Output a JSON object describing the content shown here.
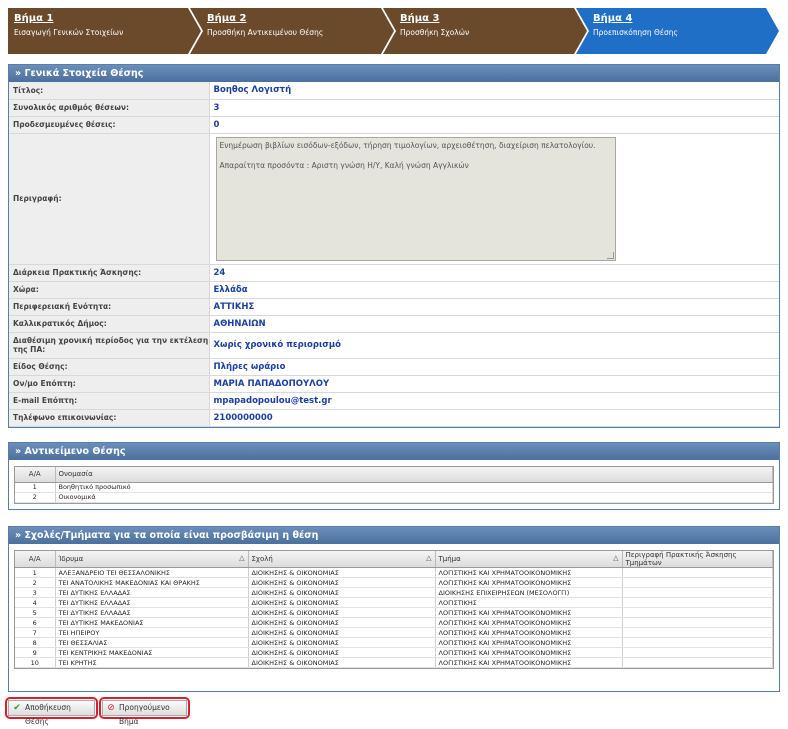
{
  "wizard": {
    "steps": [
      {
        "title": "Βήμα 1",
        "subtitle": "Εισαγωγή Γενικών Στοιχείων"
      },
      {
        "title": "Βήμα 2",
        "subtitle": "Προσθήκη Αντικειμένου Θέσης"
      },
      {
        "title": "Βήμα 3",
        "subtitle": "Προσθήκη Σχολών"
      },
      {
        "title": "Βήμα 4",
        "subtitle": "Προεπισκόπηση Θέσης"
      }
    ],
    "colors": {
      "done": "#6b4a2b",
      "active": "#1f6fc6"
    }
  },
  "general": {
    "header": "» Γενικά Στοιχεία Θέσης",
    "fields": [
      {
        "label": "Τίτλος:",
        "value": "Βοηθος Λογιστή"
      },
      {
        "label": "Συνολικός αριθμός θέσεων:",
        "value": "3"
      },
      {
        "label": "Προδεσμευμένες θέσεις:",
        "value": "0"
      },
      {
        "label": "Περιγραφή:",
        "value": ""
      },
      {
        "label": "Διάρκεια Πρακτικής Άσκησης:",
        "value": "24"
      },
      {
        "label": "Χώρα:",
        "value": "Ελλάδα"
      },
      {
        "label": "Περιφερειακή Ενότητα:",
        "value": "ΑΤΤΙΚΗΣ"
      },
      {
        "label": "Καλλικρατικός Δήμος:",
        "value": "ΑΘΗΝΑΙΩΝ"
      },
      {
        "label": "Διαθέσιμη χρονική περίοδος για την εκτέλεση της ΠΑ:",
        "value": "Χωρίς χρονικό περιορισμό"
      },
      {
        "label": "Είδος Θέσης:",
        "value": "Πλήρες ωράριο"
      },
      {
        "label": "Ον/μο Επόπτη:",
        "value": "ΜΑΡΙΑ ΠΑΠΑΔΟΠΟΥΛΟΥ"
      },
      {
        "label": "E-mail Επόπτη:",
        "value": "mpapadopoulou@test.gr"
      },
      {
        "label": "Τηλέφωνο επικοινωνίας:",
        "value": "2100000000"
      }
    ],
    "description_line1": "Ενημέρωση βιβλίων εισόδων-εξόδων, τήρηση τιμολογίων, αρχειοθέτηση, διαχείριση πελατολογίου.",
    "description_line2": "Απαραίτητα προσόντα : Αριστη γνώση Η/Υ, Καλή γνώση Αγγλικών"
  },
  "objects": {
    "header": "» Αντικείμενο Θέσης",
    "columns": [
      "Α/Α",
      "Ονομασία"
    ],
    "rows": [
      [
        "1",
        "Βοηθητικό προσωπικό"
      ],
      [
        "2",
        "Οικονομικά"
      ]
    ]
  },
  "schools": {
    "header": "» Σχολές/Τμήματα για τα οποία είναι προσβάσιμη η θέση",
    "columns": [
      "Α/Α",
      "Ίδρυμα",
      "Σχολή",
      "Τμήμα",
      "Περιγραφή Πρακτικής Άσκησης Τμημάτων"
    ],
    "rows": [
      [
        "1",
        "ΑΛΕΞΑΝΔΡΕΙΟ ΤΕΙ ΘΕΣΣΑΛΟΝΙΚΗΣ",
        "ΔΙΟΙΚΗΣΗΣ & ΟΙΚΟΝΟΜΙΑΣ",
        "ΛΟΓΙΣΤΙΚΗΣ ΚΑΙ ΧΡΗΜΑΤΟΟΙΚΟΝΟΜΙΚΗΣ",
        ""
      ],
      [
        "2",
        "ΤΕΙ ΑΝΑΤΟΛΙΚΗΣ ΜΑΚΕΔΟΝΙΑΣ ΚΑΙ ΘΡΑΚΗΣ",
        "ΔΙΟΙΚΗΣΗΣ & ΟΙΚΟΝΟΜΙΑΣ",
        "ΛΟΓΙΣΤΙΚΗΣ ΚΑΙ ΧΡΗΜΑΤΟΟΙΚΟΝΟΜΙΚΗΣ",
        ""
      ],
      [
        "3",
        "ΤΕΙ ΔΥΤΙΚΗΣ ΕΛΛΑΔΑΣ",
        "ΔΙΟΙΚΗΣΗΣ & ΟΙΚΟΝΟΜΙΑΣ",
        "ΔΙΟΙΚΗΣΗΣ ΕΠΙΧΕΙΡΗΣΕΩΝ (ΜΕΣΟΛΟΓΓΙ)",
        ""
      ],
      [
        "4",
        "ΤΕΙ ΔΥΤΙΚΗΣ ΕΛΛΑΔΑΣ",
        "ΔΙΟΙΚΗΣΗΣ & ΟΙΚΟΝΟΜΙΑΣ",
        "ΛΟΓΙΣΤΙΚΗΣ",
        ""
      ],
      [
        "5",
        "ΤΕΙ ΔΥΤΙΚΗΣ ΕΛΛΑΔΑΣ",
        "ΔΙΟΙΚΗΣΗΣ & ΟΙΚΟΝΟΜΙΑΣ",
        "ΛΟΓΙΣΤΙΚΗΣ ΚΑΙ ΧΡΗΜΑΤΟΟΙΚΟΝΟΜΙΚΗΣ",
        ""
      ],
      [
        "6",
        "ΤΕΙ ΔΥΤΙΚΗΣ ΜΑΚΕΔΟΝΙΑΣ",
        "ΔΙΟΙΚΗΣΗΣ & ΟΙΚΟΝΟΜΙΑΣ",
        "ΛΟΓΙΣΤΙΚΗΣ ΚΑΙ ΧΡΗΜΑΤΟΟΙΚΟΝΟΜΙΚΗΣ",
        ""
      ],
      [
        "7",
        "ΤΕΙ ΗΠΕΙΡΟΥ",
        "ΔΙΟΙΚΗΣΗΣ & ΟΙΚΟΝΟΜΙΑΣ",
        "ΛΟΓΙΣΤΙΚΗΣ ΚΑΙ ΧΡΗΜΑΤΟΟΙΚΟΝΟΜΙΚΗΣ",
        ""
      ],
      [
        "8",
        "ΤΕΙ ΘΕΣΣΑΛΙΑΣ",
        "ΔΙΟΙΚΗΣΗΣ & ΟΙΚΟΝΟΜΙΑΣ",
        "ΛΟΓΙΣΤΙΚΗΣ ΚΑΙ ΧΡΗΜΑΤΟΟΙΚΟΝΟΜΙΚΗΣ",
        ""
      ],
      [
        "9",
        "ΤΕΙ ΚΕΝΤΡΙΚΗΣ ΜΑΚΕΔΟΝΙΑΣ",
        "ΔΙΟΙΚΗΣΗΣ & ΟΙΚΟΝΟΜΙΑΣ",
        "ΛΟΓΙΣΤΙΚΗΣ ΚΑΙ ΧΡΗΜΑΤΟΟΙΚΟΝΟΜΙΚΗΣ",
        ""
      ],
      [
        "10",
        "ΤΕΙ ΚΡΗΤΗΣ",
        "ΔΙΟΙΚΗΣΗΣ & ΟΙΚΟΝΟΜΙΑΣ",
        "ΛΟΓΙΣΤΙΚΗΣ ΚΑΙ ΧΡΗΜΑΤΟΟΙΚΟΝΟΜΙΚΗΣ",
        ""
      ]
    ]
  },
  "buttons": {
    "save_label": "Αποθήκευση Θέσης",
    "prev_label": "Προηγούμενο Βήμα",
    "outline_color": "#d8202a"
  }
}
